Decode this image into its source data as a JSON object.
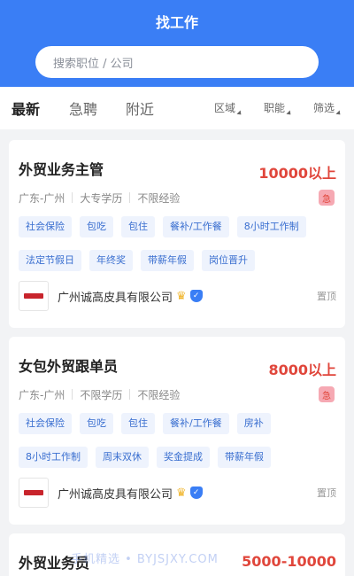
{
  "header": {
    "title": "找工作",
    "search_placeholder": "搜索职位 / 公司"
  },
  "tabs": [
    "最新",
    "急聘",
    "附近"
  ],
  "filters": [
    "区域",
    "职能",
    "筛选"
  ],
  "jobs": [
    {
      "title": "外贸业务主管",
      "salary": "10000以上",
      "location": "广东-广州",
      "education": "大专学历",
      "experience": "不限经验",
      "urgent": "急",
      "tags_row1": [
        "社会保险",
        "包吃",
        "包住",
        "餐补/工作餐",
        "8小时工作制"
      ],
      "tags_row2": [
        "法定节假日",
        "年终奖",
        "带薪年假",
        "岗位晋升"
      ],
      "company": "广州诚高皮具有限公司",
      "pinned": "置顶"
    },
    {
      "title": "女包外贸跟单员",
      "salary": "8000以上",
      "location": "广东-广州",
      "education": "不限学历",
      "experience": "不限经验",
      "urgent": "急",
      "tags_row1": [
        "社会保险",
        "包吃",
        "包住",
        "餐补/工作餐",
        "房补"
      ],
      "tags_row2": [
        "8小时工作制",
        "周末双休",
        "奖金提成",
        "带薪年假"
      ],
      "company": "广州诚高皮具有限公司",
      "pinned": "置顶"
    },
    {
      "title": "外贸业务员",
      "salary": "5000-10000"
    }
  ],
  "watermark": "手机精选 • BYJSJXY.COM",
  "colors": {
    "primary": "#3a7ef5",
    "salary": "#e0463b",
    "tag_bg": "#eef3fd",
    "tag_text": "#3a6fd0"
  }
}
